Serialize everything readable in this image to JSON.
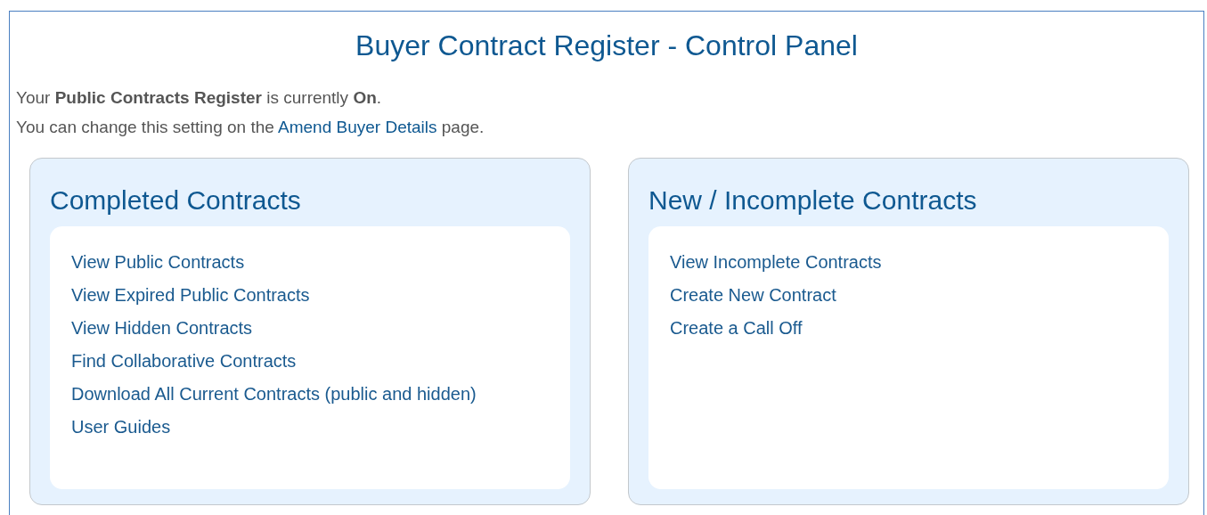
{
  "title": "Buyer Contract Register - Control Panel",
  "status_line": "Your **Public Contracts Register** is currently **On**.",
  "settings_line": {
    "prefix": "You can change this setting on the",
    "link": "Amend Buyer Details",
    "suffix": "page."
  },
  "panels": [
    {
      "title": "Completed Contracts",
      "links": [
        "View Public Contracts",
        "View Expired Public Contracts",
        "View Hidden Contracts",
        "Find Collaborative Contracts",
        "Download All Current Contracts (public and hidden)",
        "User Guides"
      ]
    },
    {
      "title": "New / Incomplete Contracts",
      "links": [
        "View Incomplete Contracts",
        "Create New Contract",
        "Create a Call Off"
      ]
    }
  ]
}
